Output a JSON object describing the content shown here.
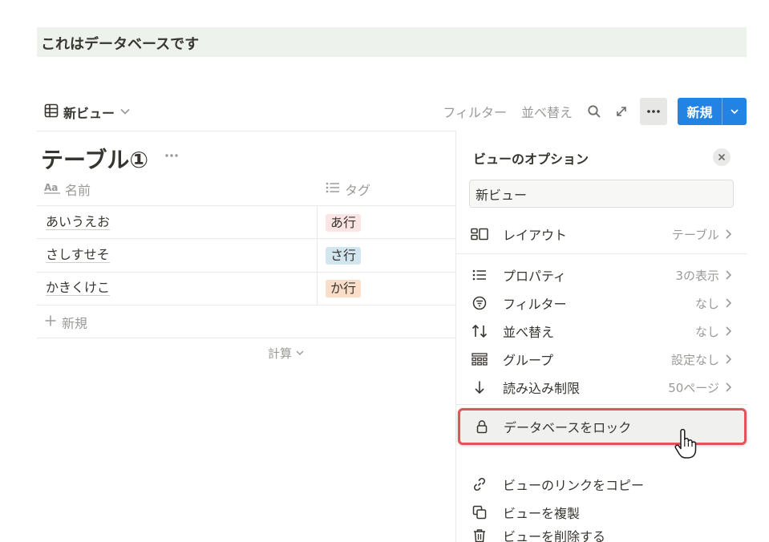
{
  "callout": {
    "text": "これはデータベースです"
  },
  "toolbar": {
    "view_label": "新ビュー",
    "filter_label": "フィルター",
    "sort_label": "並べ替え",
    "new_label": "新規"
  },
  "table": {
    "title": "テーブル①",
    "columns": [
      {
        "icon": "text-aa-icon",
        "label": "名前"
      },
      {
        "icon": "list-icon",
        "label": "タグ"
      }
    ],
    "rows": [
      {
        "name": "あいうえお",
        "tag": "あ行",
        "tag_color": "#fbe4e4"
      },
      {
        "name": "さしすせそ",
        "tag": "さ行",
        "tag_color": "#d3e5ef"
      },
      {
        "name": "かきくけこ",
        "tag": "か行",
        "tag_color": "#fadec9"
      }
    ],
    "add_row_label": "新規",
    "calc_label": "計算"
  },
  "panel": {
    "title": "ビューのオプション",
    "view_name": "新ビュー",
    "layout": {
      "label": "レイアウト",
      "value": "テーブル"
    },
    "items": [
      {
        "icon": "list-icon",
        "label": "プロパティ",
        "value": "3の表示"
      },
      {
        "icon": "filter-icon",
        "label": "フィルター",
        "value": "なし"
      },
      {
        "icon": "sort-icon",
        "label": "並べ替え",
        "value": "なし"
      },
      {
        "icon": "group-icon",
        "label": "グループ",
        "value": "設定なし"
      },
      {
        "icon": "arrow-down-icon",
        "label": "読み込み制限",
        "value": "50ページ"
      }
    ],
    "actions": [
      {
        "icon": "lock-icon",
        "label": "データベースをロック"
      },
      {
        "icon": "link-icon",
        "label": "ビューのリンクをコピー"
      },
      {
        "icon": "duplicate-icon",
        "label": "ビューを複製"
      },
      {
        "icon": "trash-icon",
        "label": "ビューを削除する"
      }
    ]
  },
  "colors": {
    "accent": "#2383e2",
    "callout_bg": "#edf3ec",
    "highlight_border": "#e0545a"
  }
}
